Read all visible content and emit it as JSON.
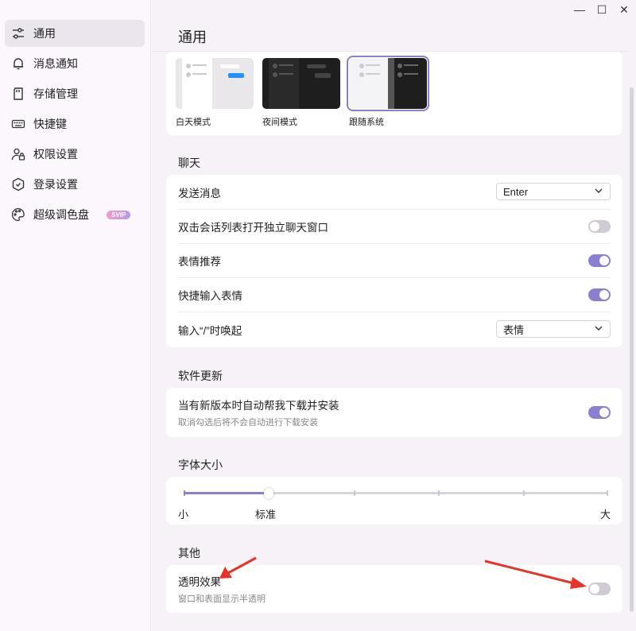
{
  "sidebar": {
    "items": [
      {
        "label": "通用",
        "icon": "sliders-icon",
        "active": true
      },
      {
        "label": "消息通知",
        "icon": "bell-icon"
      },
      {
        "label": "存储管理",
        "icon": "storage-card-icon"
      },
      {
        "label": "快捷键",
        "icon": "keyboard-icon"
      },
      {
        "label": "权限设置",
        "icon": "user-lock-icon"
      },
      {
        "label": "登录设置",
        "icon": "shield-icon"
      },
      {
        "label": "超级调色盘",
        "icon": "palette-icon",
        "badge": "SVIP"
      }
    ]
  },
  "window": {
    "minimize": "—",
    "maximize": "☐",
    "close": "✕"
  },
  "main": {
    "title": "通用",
    "themes": [
      {
        "label": "白天模式",
        "selected": false
      },
      {
        "label": "夜间模式",
        "selected": false
      },
      {
        "label": "跟随系统",
        "selected": true
      }
    ],
    "chat": {
      "heading": "聊天",
      "send_message": {
        "label": "发送消息",
        "value": "Enter"
      },
      "double_click": {
        "label": "双击会话列表打开独立聊天窗口",
        "on": false
      },
      "emoji_recommend": {
        "label": "表情推荐",
        "on": true
      },
      "quick_emoji": {
        "label": "快捷输入表情",
        "on": true
      },
      "slash_invoke": {
        "label": "输入“/”时唤起",
        "value": "表情"
      }
    },
    "update": {
      "heading": "软件更新",
      "auto_update": {
        "label": "当有新版本时自动帮我下载并安装",
        "sub": "取消勾选后将不会自动进行下载安装",
        "on": true
      }
    },
    "font_size": {
      "heading": "字体大小",
      "min_label": "小",
      "standard_label": "标准",
      "max_label": "大",
      "level": 1,
      "steps": 6
    },
    "other": {
      "heading": "其他",
      "transparency": {
        "label": "透明效果",
        "sub": "窗口和表面显示半透明",
        "on": false
      }
    }
  },
  "colors": {
    "accent": "#8b7fd0",
    "annotation": "#e8332a"
  }
}
